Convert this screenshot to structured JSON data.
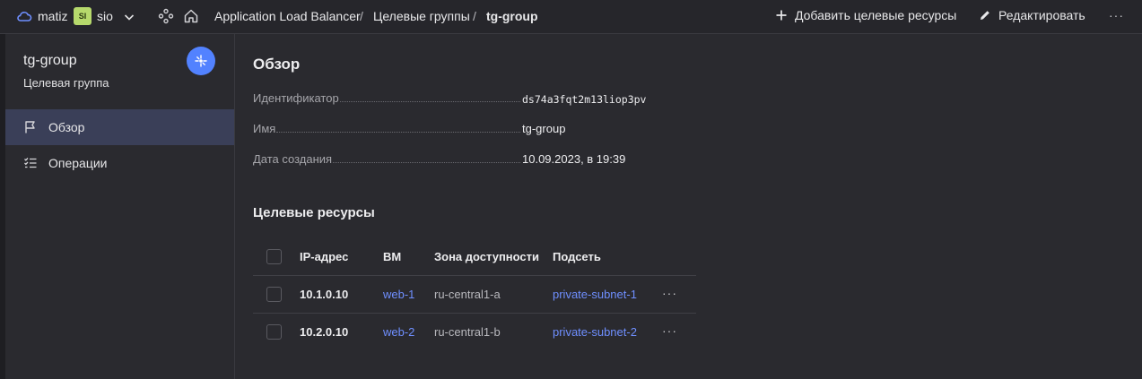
{
  "topbar": {
    "cloud_name": "matiz",
    "folder_badge": "SI",
    "folder_name": "sio",
    "breadcrumbs": [
      "Application Load Balancer",
      "Целевые группы",
      "tg-group"
    ],
    "separator": "/",
    "add_label": "Добавить целевые ресурсы",
    "edit_label": "Редактировать",
    "more": "···"
  },
  "sidebar": {
    "title": "tg-group",
    "subtitle": "Целевая группа",
    "items": [
      {
        "label": "Обзор",
        "icon": "flag-icon",
        "active": true
      },
      {
        "label": "Операции",
        "icon": "list-icon",
        "active": false
      }
    ]
  },
  "overview": {
    "heading": "Обзор",
    "fields": [
      {
        "label": "Идентификатор",
        "value": "ds74a3fqt2m13liop3pv"
      },
      {
        "label": "Имя",
        "value": "tg-group"
      },
      {
        "label": "Дата создания",
        "value": "10.09.2023, в 19:39"
      }
    ]
  },
  "targets": {
    "heading": "Целевые ресурсы",
    "columns": [
      "IP-адрес",
      "ВМ",
      "Зона доступности",
      "Подсеть"
    ],
    "rows": [
      {
        "ip": "10.1.0.10",
        "vm": "web-1",
        "zone": "ru-central1-a",
        "subnet": "private-subnet-1",
        "more": "···"
      },
      {
        "ip": "10.2.0.10",
        "vm": "web-2",
        "zone": "ru-central1-b",
        "subnet": "private-subnet-2",
        "more": "···"
      }
    ]
  },
  "colors": {
    "accent": "#5282ff",
    "link": "#6f8fff",
    "folder_badge": "#b6d96c",
    "active_item": "#3a3f58"
  }
}
